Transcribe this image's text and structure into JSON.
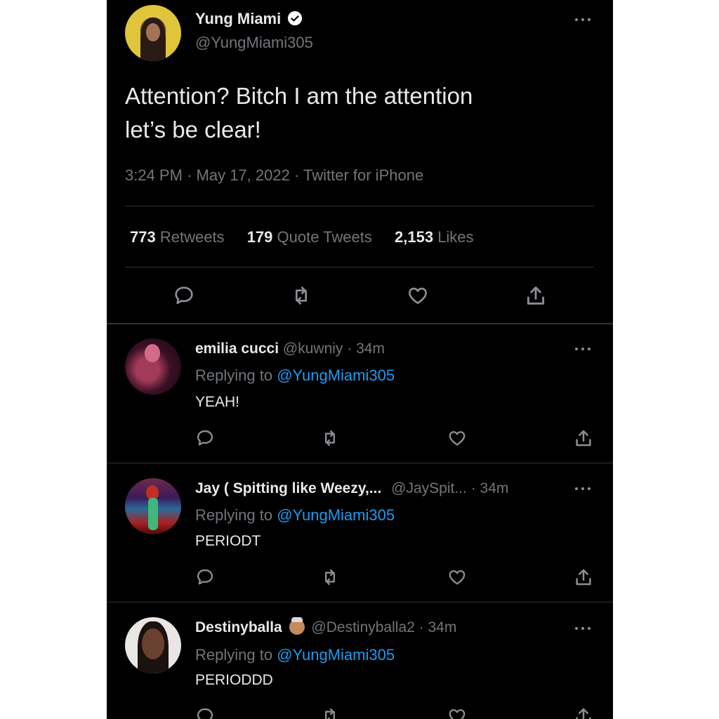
{
  "tweet": {
    "author_name": "Yung Miami",
    "handle": "@YungMiami305",
    "text_line1": "Attention? Bitch I am the attention",
    "text_line2": "let’s be clear!",
    "time": "3:24 PM",
    "date": "May 17, 2022",
    "source": "Twitter for iPhone",
    "separator": "·",
    "stats": {
      "retweets_count": "773",
      "retweets_label": "Retweets",
      "quotes_count": "179",
      "quotes_label": "Quote Tweets",
      "likes_count": "2,153",
      "likes_label": "Likes"
    }
  },
  "replies": [
    {
      "name": "emilia cucci",
      "handle": "@kuwniy",
      "time": "· 34m",
      "replying_prefix": "Replying to",
      "replying_handle": "@YungMiami305",
      "text": "YEAH!"
    },
    {
      "name": "Jay ( Spitting like Weezy,...",
      "handle": "@JaySpit...",
      "time": "· 34m",
      "replying_prefix": "Replying to",
      "replying_handle": "@YungMiami305",
      "text": "PERIODT"
    },
    {
      "name": "Destinyballa",
      "handle": "@Destinyballa2",
      "time": "· 34m",
      "replying_prefix": "Replying to",
      "replying_handle": "@YungMiami305",
      "text": "PERIODDD"
    }
  ],
  "colors": {
    "background": "#000000",
    "text": "#e7e9ea",
    "muted": "#71767b",
    "link": "#1d9bf0",
    "verified": "#ffffff"
  },
  "icons": [
    "verified-badge-icon",
    "more-icon",
    "reply-icon",
    "retweet-icon",
    "like-icon",
    "share-icon",
    "emoji-icon"
  ]
}
